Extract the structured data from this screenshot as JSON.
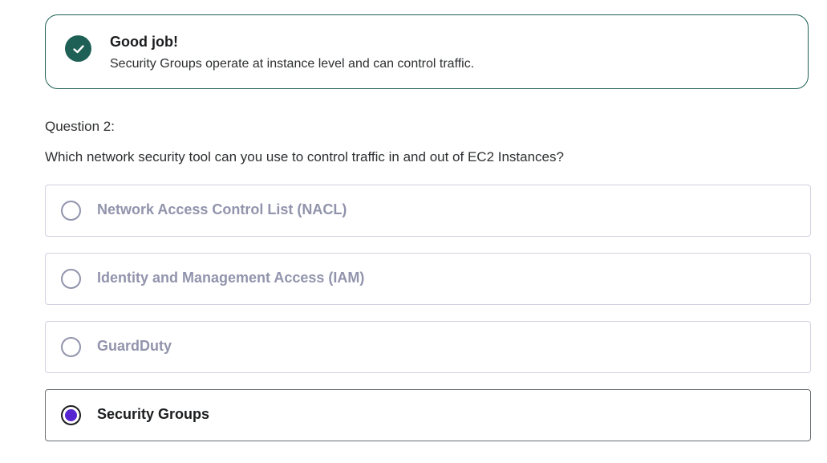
{
  "feedback": {
    "icon": "check-circle-icon",
    "title": "Good job!",
    "message": "Security Groups operate at instance level and can control traffic.",
    "accent_color": "#1e6055"
  },
  "question": {
    "number_label": "Question 2:",
    "text": "Which network security tool can you use to control traffic in and out of EC2 Instances?"
  },
  "options": [
    {
      "label": "Network Access Control List (NACL)",
      "selected": false
    },
    {
      "label": "Identity and Management Access (IAM)",
      "selected": false
    },
    {
      "label": "GuardDuty",
      "selected": false
    },
    {
      "label": "Security Groups",
      "selected": true
    }
  ],
  "colors": {
    "selected_radio": "#5624d0",
    "unselected_text": "#9194ac"
  }
}
